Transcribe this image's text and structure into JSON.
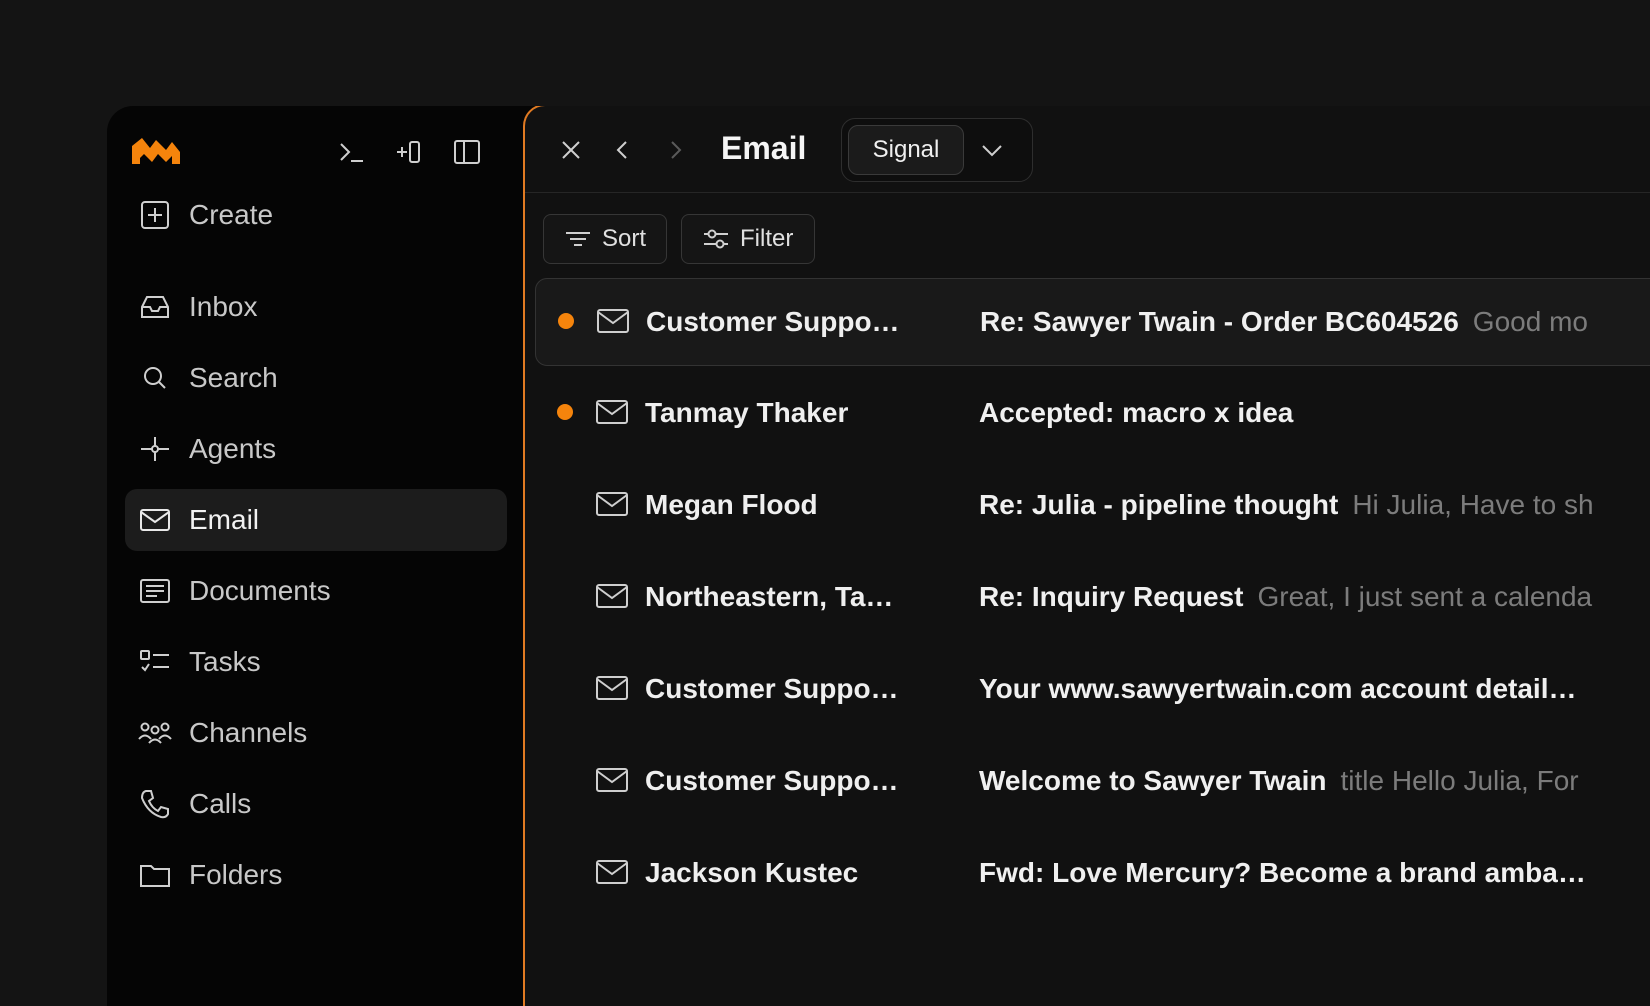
{
  "sidebar": {
    "nav": [
      {
        "label": "Create",
        "icon": "plus-square-icon"
      },
      {
        "label": "Inbox",
        "icon": "inbox-icon"
      },
      {
        "label": "Search",
        "icon": "search-icon"
      },
      {
        "label": "Agents",
        "icon": "sparkle-icon"
      },
      {
        "label": "Email",
        "icon": "mail-icon",
        "active": true
      },
      {
        "label": "Documents",
        "icon": "document-icon"
      },
      {
        "label": "Tasks",
        "icon": "tasks-icon"
      },
      {
        "label": "Channels",
        "icon": "people-icon"
      },
      {
        "label": "Calls",
        "icon": "phone-icon"
      },
      {
        "label": "Folders",
        "icon": "folder-icon"
      }
    ]
  },
  "header": {
    "title": "Email",
    "segment_selected": "Signal"
  },
  "toolbar": {
    "sort_label": "Sort",
    "filter_label": "Filter"
  },
  "emails": [
    {
      "sender": "Customer Suppo…",
      "subject": "Re: Sawyer Twain - Order BC604526",
      "preview": "Good mo",
      "unread": true,
      "selected": true
    },
    {
      "sender": "Tanmay Thaker",
      "subject": "Accepted: macro x idea",
      "preview": "",
      "unread": true
    },
    {
      "sender": "Megan Flood",
      "subject": "Re: Julia - pipeline thought",
      "preview": "Hi Julia, Have to sh",
      "unread": false
    },
    {
      "sender": "Northeastern, Ta…",
      "subject": "Re: Inquiry Request",
      "preview": "Great, I just sent a calenda",
      "unread": false
    },
    {
      "sender": "Customer Suppo…",
      "subject": "Your www.sawyertwain.com account detail…",
      "preview": "",
      "unread": false
    },
    {
      "sender": "Customer Suppo…",
      "subject": "Welcome to Sawyer Twain",
      "preview": "title Hello Julia, For",
      "unread": false
    },
    {
      "sender": "Jackson Kustec",
      "subject": "Fwd: Love Mercury? Become a brand amba…",
      "preview": "",
      "unread": false
    }
  ],
  "colors": {
    "accent": "#f5840c",
    "background": "#141414",
    "panel": "#111111"
  }
}
